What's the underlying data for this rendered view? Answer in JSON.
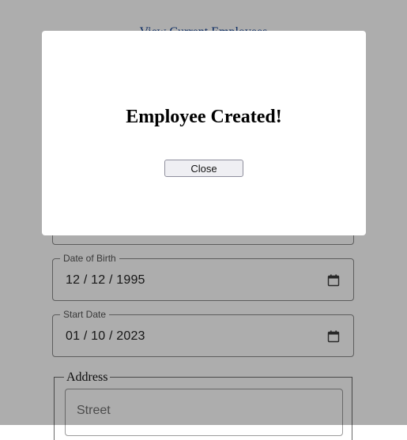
{
  "page": {
    "top_link": "View Current Employees"
  },
  "form": {
    "date_of_birth": {
      "label": "Date of Birth",
      "value": "12 / 12 / 1995"
    },
    "start_date": {
      "label": "Start Date",
      "value": "01 / 10 / 2023"
    },
    "address": {
      "legend": "Address",
      "street_placeholder": "Street"
    }
  },
  "modal": {
    "title": "Employee Created!",
    "close_label": "Close"
  },
  "colors": {
    "overlay": "rgba(0,0,0,0.32)",
    "link": "#0a3a8c",
    "icons": [
      "calendar-icon"
    ]
  }
}
